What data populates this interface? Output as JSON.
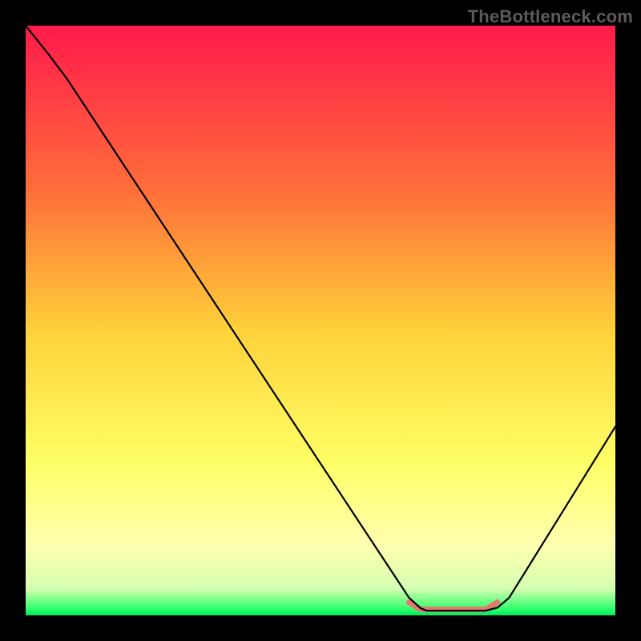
{
  "watermark": "TheBottleneck.com",
  "chart_data": {
    "type": "line",
    "title": "",
    "xlabel": "",
    "ylabel": "",
    "x_range": [
      0,
      100
    ],
    "y_range": [
      0,
      100
    ],
    "gradient_stops": [
      {
        "offset": 0,
        "color": "#ff1a4b"
      },
      {
        "offset": 0.28,
        "color": "#ff6e3a"
      },
      {
        "offset": 0.52,
        "color": "#ffd23a"
      },
      {
        "offset": 0.74,
        "color": "#ffff66"
      },
      {
        "offset": 0.88,
        "color": "#ffffb0"
      },
      {
        "offset": 0.955,
        "color": "#d5ffb0"
      },
      {
        "offset": 0.99,
        "color": "#2aff6a"
      },
      {
        "offset": 1.0,
        "color": "#00e85a"
      }
    ],
    "series": [
      {
        "name": "bottleneck-curve",
        "color": "#000000",
        "width": 2.2,
        "points": [
          {
            "x": 0,
            "y": 100
          },
          {
            "x": 4,
            "y": 95
          },
          {
            "x": 7,
            "y": 91
          },
          {
            "x": 65,
            "y": 3
          },
          {
            "x": 67,
            "y": 1.2
          },
          {
            "x": 68,
            "y": 0.8
          },
          {
            "x": 78,
            "y": 0.8
          },
          {
            "x": 80,
            "y": 1.3
          },
          {
            "x": 82,
            "y": 3
          },
          {
            "x": 100,
            "y": 32
          }
        ]
      }
    ],
    "highlight": {
      "name": "optimal-range",
      "color": "#e4786c",
      "width": 7,
      "points": [
        {
          "x": 65,
          "y": 2.2
        },
        {
          "x": 67,
          "y": 1.0
        },
        {
          "x": 78,
          "y": 1.0
        },
        {
          "x": 80,
          "y": 2.2
        }
      ]
    }
  }
}
